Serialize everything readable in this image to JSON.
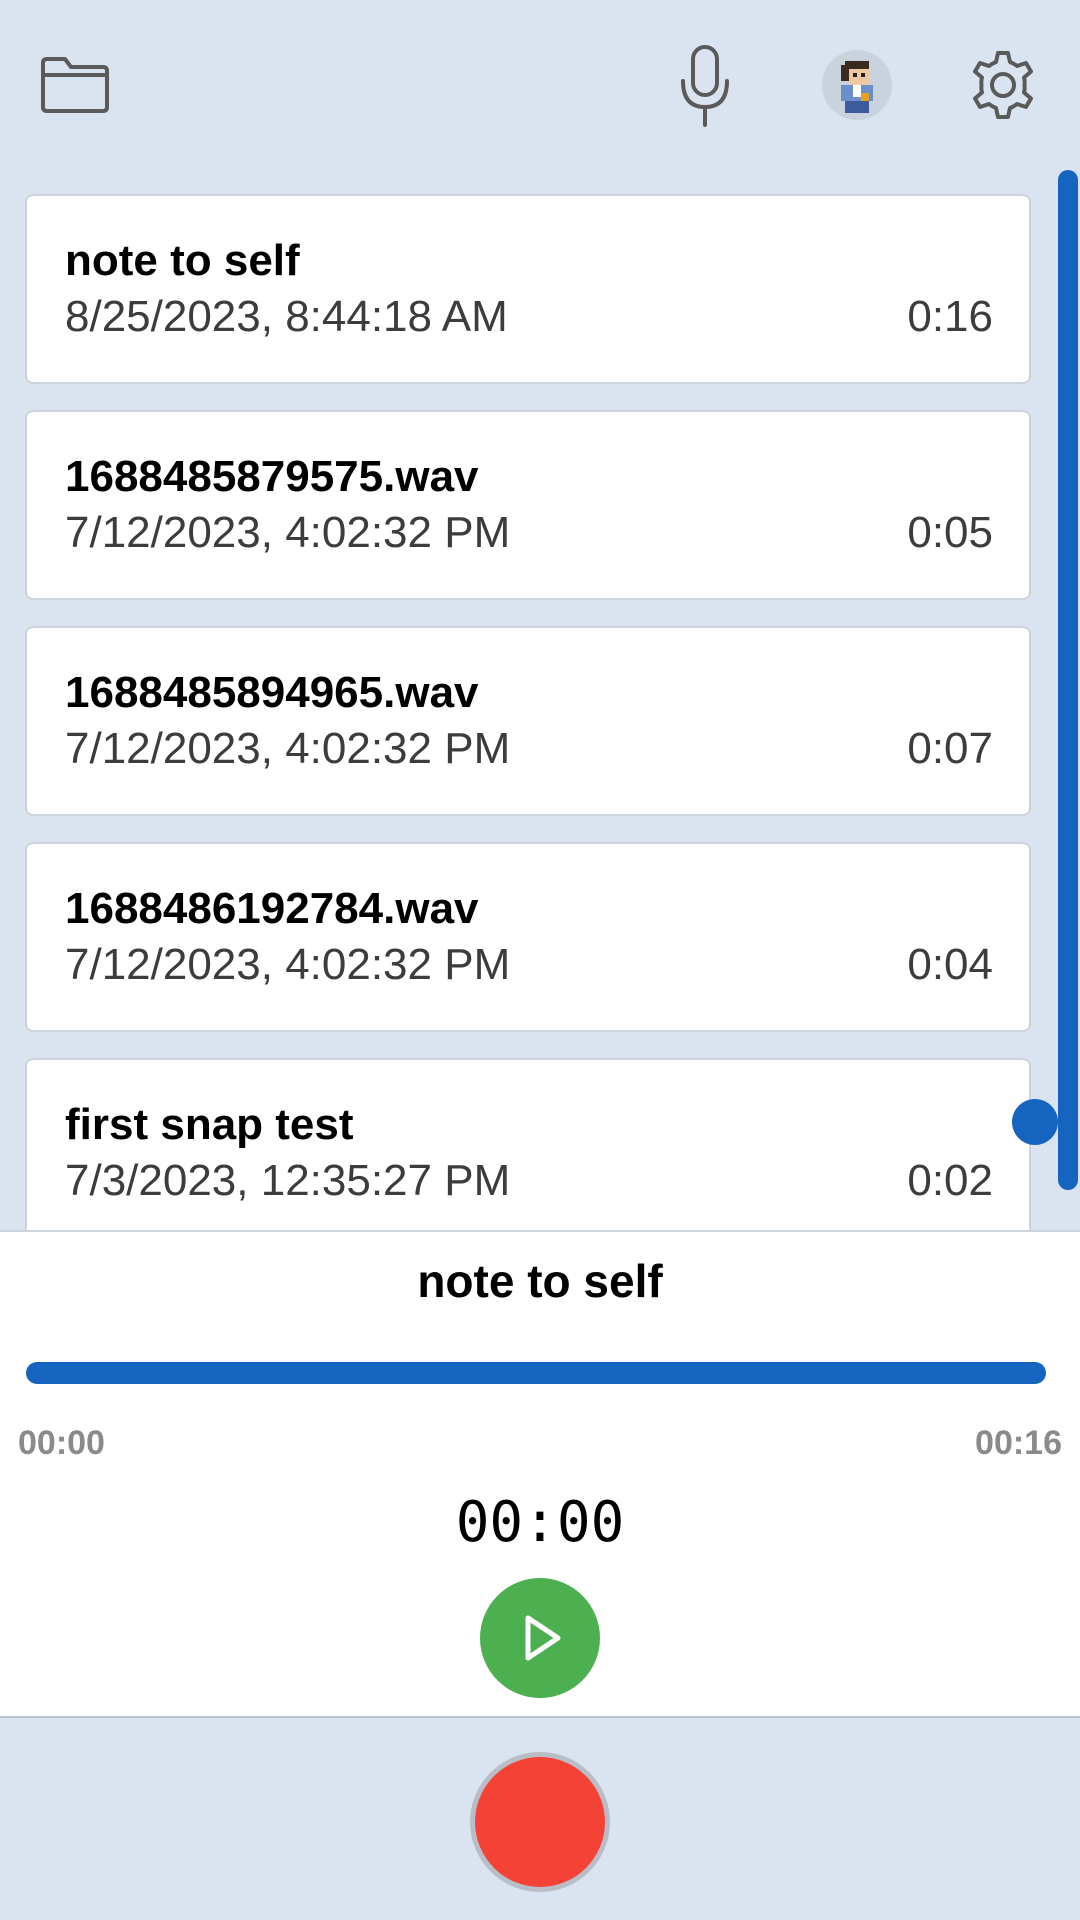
{
  "topbar": {
    "icons": [
      "folder-icon",
      "microphone-icon",
      "avatar",
      "gear-icon"
    ]
  },
  "recordings": [
    {
      "name": "note to self",
      "date": "8/25/2023, 8:44:18 AM",
      "duration": "0:16"
    },
    {
      "name": "1688485879575.wav",
      "date": "7/12/2023, 4:02:32 PM",
      "duration": "0:05"
    },
    {
      "name": "1688485894965.wav",
      "date": "7/12/2023, 4:02:32 PM",
      "duration": "0:07"
    },
    {
      "name": "1688486192784.wav",
      "date": "7/12/2023, 4:02:32 PM",
      "duration": "0:04"
    },
    {
      "name": "first snap test",
      "date": "7/3/2023, 12:35:27 PM",
      "duration": "0:02"
    }
  ],
  "player": {
    "title": "note to self",
    "start_time": "00:00",
    "end_time": "00:16",
    "current_time": "00:00",
    "progress": 1.0
  },
  "colors": {
    "background": "#dae4f1",
    "accent": "#1565c0",
    "play": "#4caf50",
    "record": "#f44336"
  }
}
